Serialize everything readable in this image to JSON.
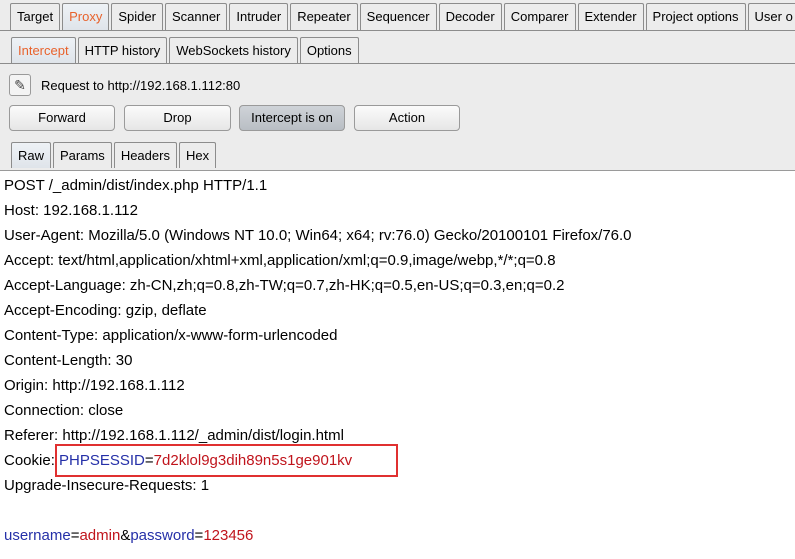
{
  "main_tabs": [
    "Target",
    "Proxy",
    "Spider",
    "Scanner",
    "Intruder",
    "Repeater",
    "Sequencer",
    "Decoder",
    "Comparer",
    "Extender",
    "Project options",
    "User o"
  ],
  "proxy_tabs": [
    "Intercept",
    "HTTP history",
    "WebSockets history",
    "Options"
  ],
  "request_to": "Request to http://192.168.1.112:80",
  "buttons": {
    "forward": "Forward",
    "drop": "Drop",
    "intercept": "Intercept is on",
    "action": "Action"
  },
  "view_tabs": [
    "Raw",
    "Params",
    "Headers",
    "Hex"
  ],
  "request_lines": [
    "POST /_admin/dist/index.php HTTP/1.1",
    "Host: 192.168.1.112",
    "User-Agent: Mozilla/5.0 (Windows NT 10.0; Win64; x64; rv:76.0) Gecko/20100101 Firefox/76.0",
    "Accept: text/html,application/xhtml+xml,application/xml;q=0.9,image/webp,*/*;q=0.8",
    "Accept-Language: zh-CN,zh;q=0.8,zh-TW;q=0.7,zh-HK;q=0.5,en-US;q=0.3,en;q=0.2",
    "Accept-Encoding: gzip, deflate",
    "Content-Type: application/x-www-form-urlencoded",
    "Content-Length: 30",
    "Origin: http://192.168.1.112",
    "Connection: close",
    "Referer: http://192.168.1.112/_admin/dist/login.html"
  ],
  "cookie": {
    "label": "Cookie: ",
    "name": "PHPSESSID",
    "eq": "=",
    "value": "7d2klol9g3dih89n5s1ge901kv"
  },
  "upgrade_line": "Upgrade-Insecure-Requests: 1",
  "body": {
    "user_key": "username",
    "eq1": "=",
    "user_val": "admin",
    "amp": "&",
    "pass_key": "password",
    "eq2": "=",
    "pass_val": "123456"
  },
  "colors": {
    "active_tab_text": "#e8622c",
    "param_key": "#2530a8",
    "param_value": "#c0141c",
    "highlight_box": "#e03030"
  }
}
